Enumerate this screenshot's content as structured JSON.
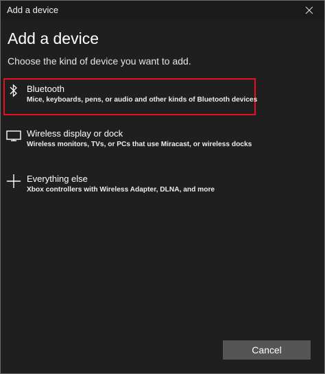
{
  "window": {
    "title": "Add a device"
  },
  "main": {
    "heading": "Add a device",
    "subheading": "Choose the kind of device you want to add.",
    "options": [
      {
        "title": "Bluetooth",
        "description": "Mice, keyboards, pens, or audio and other kinds of Bluetooth devices",
        "icon": "bluetooth-icon",
        "selected": true
      },
      {
        "title": "Wireless display or dock",
        "description": "Wireless monitors, TVs, or PCs that use Miracast, or wireless docks",
        "icon": "monitor-icon",
        "selected": false
      },
      {
        "title": "Everything else",
        "description": "Xbox controllers with Wireless Adapter, DLNA, and more",
        "icon": "plus-icon",
        "selected": false
      }
    ]
  },
  "footer": {
    "cancel_label": "Cancel"
  },
  "colors": {
    "background": "#1f1f1f",
    "highlight": "#e81123",
    "button": "#555555"
  }
}
